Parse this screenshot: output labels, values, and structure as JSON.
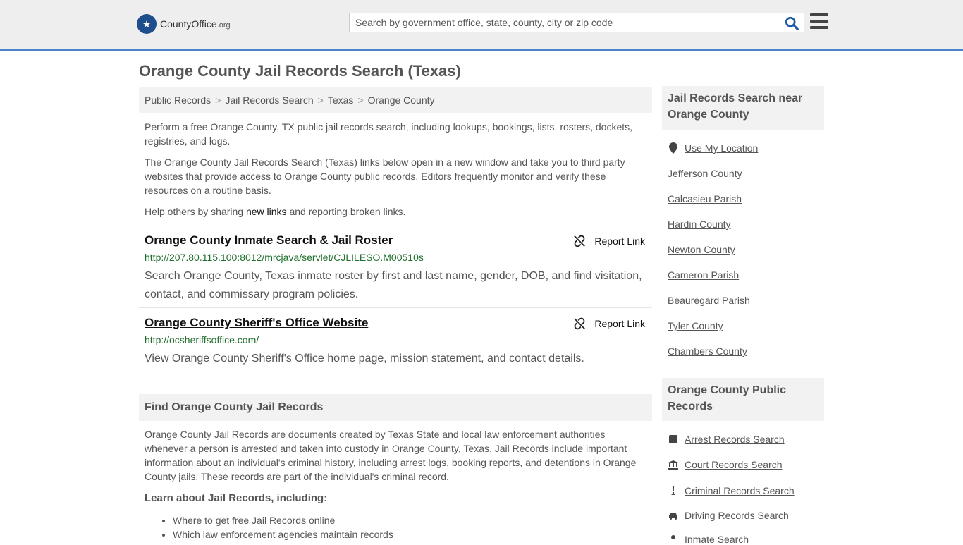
{
  "header": {
    "logo_main": "CountyOffice",
    "logo_tld": ".org",
    "search_placeholder": "Search by government office, state, county, city or zip code"
  },
  "page_title": "Orange County Jail Records Search (Texas)",
  "breadcrumb": [
    "Public Records",
    "Jail Records Search",
    "Texas",
    "Orange County"
  ],
  "intro": {
    "p1": "Perform a free Orange County, TX public jail records search, including lookups, bookings, lists, rosters, dockets, registries, and logs.",
    "p2": "The Orange County Jail Records Search (Texas) links below open in a new window and take you to third party websites that provide access to Orange County public records. Editors frequently monitor and verify these resources on a routine basis.",
    "p3_before": "Help others by sharing ",
    "p3_link": "new links",
    "p3_after": " and reporting broken links."
  },
  "results": [
    {
      "title": "Orange County Inmate Search & Jail Roster",
      "report": "Report Link",
      "url": "http://207.80.115.100:8012/mrcjava/servlet/CJLILESO.M00510s",
      "desc": "Search Orange County, Texas inmate roster by first and last name, gender, DOB, and find visitation, contact, and commissary program policies."
    },
    {
      "title": "Orange County Sheriff's Office Website",
      "report": "Report Link",
      "url": "http://ocsheriffsoffice.com/",
      "desc": "View Orange County Sheriff's Office home page, mission statement, and contact details."
    }
  ],
  "find_section": {
    "heading": "Find Orange County Jail Records",
    "body": "Orange County Jail Records are documents created by Texas State and local law enforcement authorities whenever a person is arrested and taken into custody in Orange County, Texas. Jail Records include important information about an individual's criminal history, including arrest logs, booking reports, and detentions in Orange County jails. These records are part of the individual's criminal record.",
    "learn": "Learn about Jail Records, including:",
    "bullets": [
      "Where to get free Jail Records online",
      "Which law enforcement agencies maintain records"
    ]
  },
  "sidebar": {
    "near_heading": "Jail Records Search near Orange County",
    "use_location": "Use My Location",
    "near_links": [
      "Jefferson County",
      "Calcasieu Parish",
      "Hardin County",
      "Newton County",
      "Cameron Parish",
      "Beauregard Parish",
      "Tyler County",
      "Chambers County"
    ],
    "public_heading": "Orange County Public Records",
    "public_links": [
      {
        "label": "Arrest Records Search",
        "icon": "square-icon"
      },
      {
        "label": "Court Records Search",
        "icon": "courthouse-icon"
      },
      {
        "label": "Criminal Records Search",
        "icon": "exclamation-icon"
      },
      {
        "label": "Driving Records Search",
        "icon": "car-icon"
      },
      {
        "label": "Inmate Search",
        "icon": "person-icon"
      }
    ]
  },
  "colors": {
    "accent": "#4a83c8",
    "url_green": "#1f6f2c",
    "logo_blue": "#1f4e8c"
  }
}
